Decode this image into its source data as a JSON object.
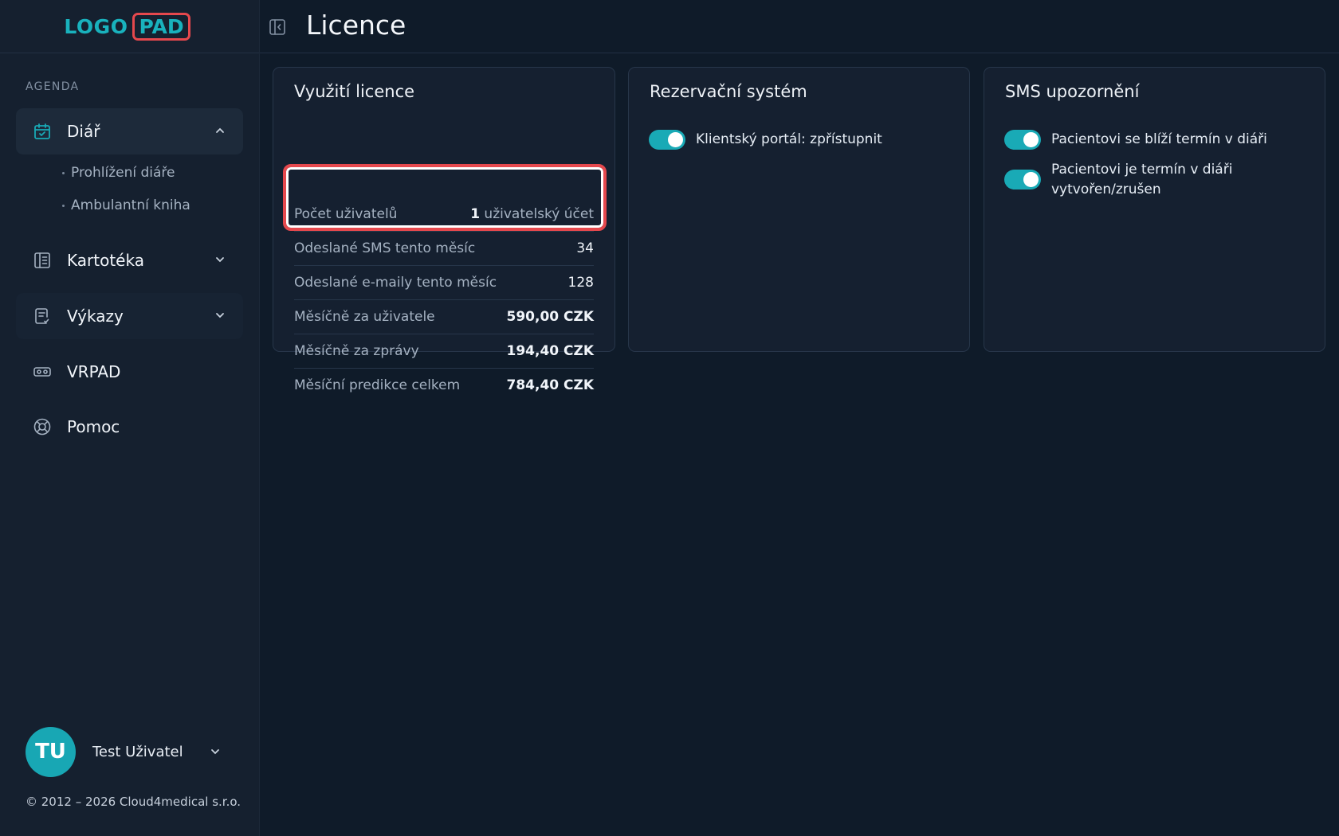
{
  "logo": {
    "part1": "LOGO",
    "part2": "PAD"
  },
  "sidebar": {
    "section_label": "AGENDA",
    "items": [
      {
        "label": "Diář",
        "icon": "calendar-check-icon",
        "expanded": true,
        "children": [
          "Prohlížení diáře",
          "Ambulantní kniha"
        ]
      },
      {
        "label": "Kartotéka",
        "icon": "book-icon",
        "expanded": false
      },
      {
        "label": "Výkazy",
        "icon": "report-icon",
        "expanded": false
      },
      {
        "label": "VRPAD",
        "icon": "vr-headset-icon"
      },
      {
        "label": "Pomoc",
        "icon": "lifebuoy-icon"
      }
    ],
    "user": {
      "initials": "TU",
      "name": "Test Uživatel"
    },
    "copyright": "© 2012 – 2026 Cloud4medical s.r.o."
  },
  "header": {
    "title": "Licence"
  },
  "license_card": {
    "title": "Využití licence",
    "rows": [
      {
        "key": "Počet uživatelů",
        "value_num": "1",
        "value_text": " uživatelský účet"
      },
      {
        "key": "Odeslané SMS tento měsíc",
        "value": "34"
      },
      {
        "key": "Odeslané e-maily tento měsíc",
        "value": "128"
      },
      {
        "key": "Měsíčně za uživatele",
        "value": "590,00 CZK"
      },
      {
        "key": "Měsíčně za zprávy",
        "value": "194,40 CZK"
      },
      {
        "key": "Měsíční predikce celkem",
        "value": "784,40 CZK"
      }
    ]
  },
  "reservation_card": {
    "title": "Rezervační systém",
    "toggles": [
      {
        "label": "Klientský portál: zpřístupnit",
        "on": true
      }
    ]
  },
  "sms_card": {
    "title": "SMS upozornění",
    "toggles": [
      {
        "label": "Pacientovi se blíží termín v diáři",
        "on": true
      },
      {
        "label_line1": "Pacientovi je termín v diáři",
        "label_line2": "vytvořen/zrušen",
        "on": true
      }
    ]
  },
  "colors": {
    "accent": "#19aab6",
    "highlight": "#e5484d",
    "background": "#0f1b29",
    "sidebar": "#15202f"
  }
}
